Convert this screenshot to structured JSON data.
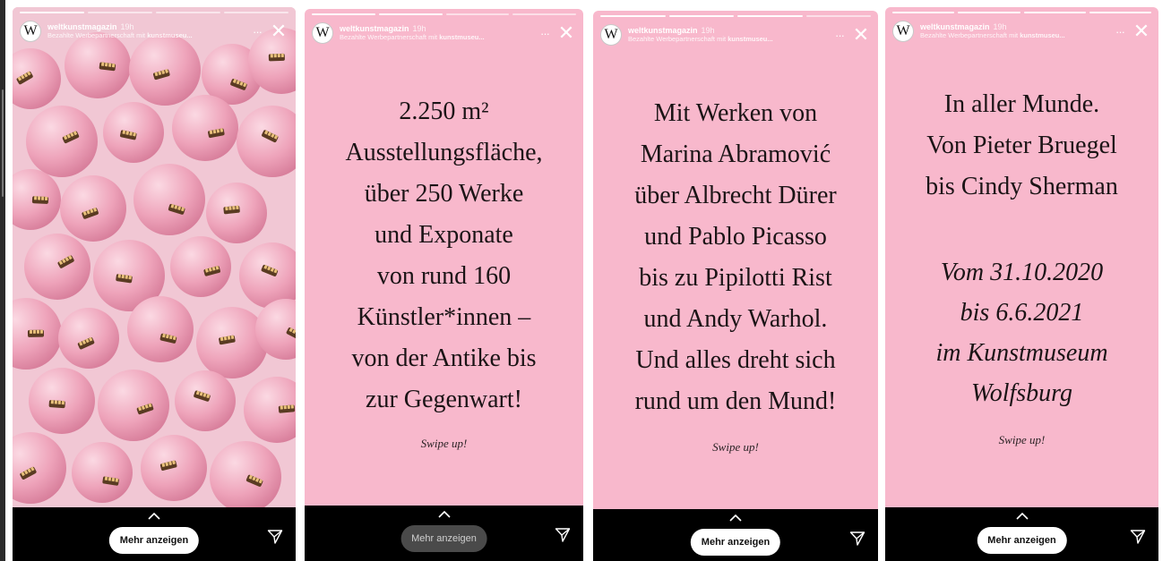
{
  "stories": [
    {
      "account": "weltkunstmagazin",
      "time": "19h",
      "sponsor_prefix": "Bezahlte Werbepartnerschaft mit",
      "sponsor_brand": "kunstmuseu...",
      "avatar_letter": "W",
      "more": "···",
      "close": "✕",
      "cta": "Mehr anzeigen"
    },
    {
      "account": "weltkunstmagazin",
      "time": "19h",
      "sponsor_prefix": "Bezahlte Werbepartnerschaft mit",
      "sponsor_brand": "kunstmuseu...",
      "avatar_letter": "W",
      "more": "···",
      "close": "✕",
      "lines": [
        "2.250 m²",
        "Ausstellungsfläche,",
        "über 250 Werke",
        "und Exponate",
        "von rund 160",
        "Künstler*innen –",
        "von der Antike bis",
        "zur Gegenwart!"
      ],
      "swipe": "Swipe up!",
      "cta": "Mehr anzeigen"
    },
    {
      "account": "weltkunstmagazin",
      "time": "19h",
      "sponsor_prefix": "Bezahlte Werbepartnerschaft mit",
      "sponsor_brand": "kunstmuseu...",
      "avatar_letter": "W",
      "more": "···",
      "close": "✕",
      "lines": [
        "Mit Werken von",
        "Marina Abramović",
        "über Albrecht Dürer",
        "und Pablo Picasso",
        "bis zu Pipilotti Rist",
        "und Andy Warhol.",
        "Und alles dreht sich",
        "rund um den Mund!"
      ],
      "swipe": "Swipe up!",
      "cta": "Mehr anzeigen"
    },
    {
      "account": "weltkunstmagazin",
      "time": "19h",
      "sponsor_prefix": "Bezahlte Werbepartnerschaft mit",
      "sponsor_brand": "kunstmuseu...",
      "avatar_letter": "W",
      "more": "···",
      "close": "✕",
      "lines_top": [
        "In aller Munde.",
        "Von Pieter Bruegel",
        "bis Cindy Sherman"
      ],
      "lines_italic": [
        "Vom 31.10.2020",
        "bis 6.6.2021",
        "im Kunstmuseum",
        "Wolfsburg"
      ],
      "swipe": "Swipe up!",
      "cta": "Mehr anzeigen"
    }
  ],
  "colors": {
    "story_pink": "#f8b8cc",
    "text_dark": "#1b1416",
    "bar_black": "#000000"
  }
}
